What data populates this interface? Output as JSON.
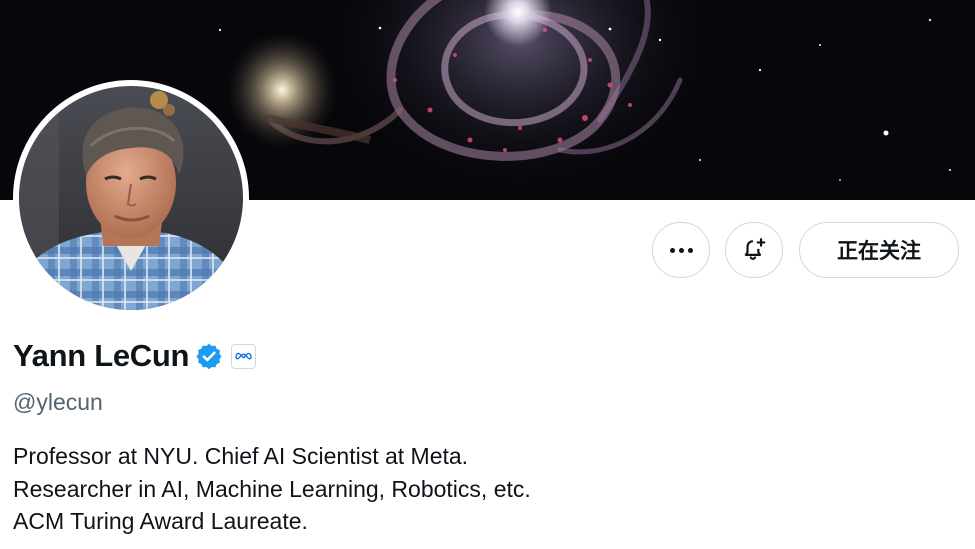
{
  "profile": {
    "display_name": "Yann LeCun",
    "handle": "@ylecun",
    "verified": true,
    "affiliation_icon": "meta-logo-icon",
    "bio": [
      "Professor at NYU. Chief AI Scientist at Meta.",
      "Researcher in AI, Machine Learning, Robotics, etc.",
      "ACM Turing Award Laureate."
    ]
  },
  "actions": {
    "more_icon": "more-horizontal-icon",
    "notify_icon": "bell-plus-icon",
    "follow_label": "正在关注"
  },
  "colors": {
    "verified_blue": "#1d9bf0",
    "text_primary": "#0f1419",
    "text_secondary": "#536471",
    "border": "#cfd9de",
    "banner_bg": "#07070b"
  }
}
